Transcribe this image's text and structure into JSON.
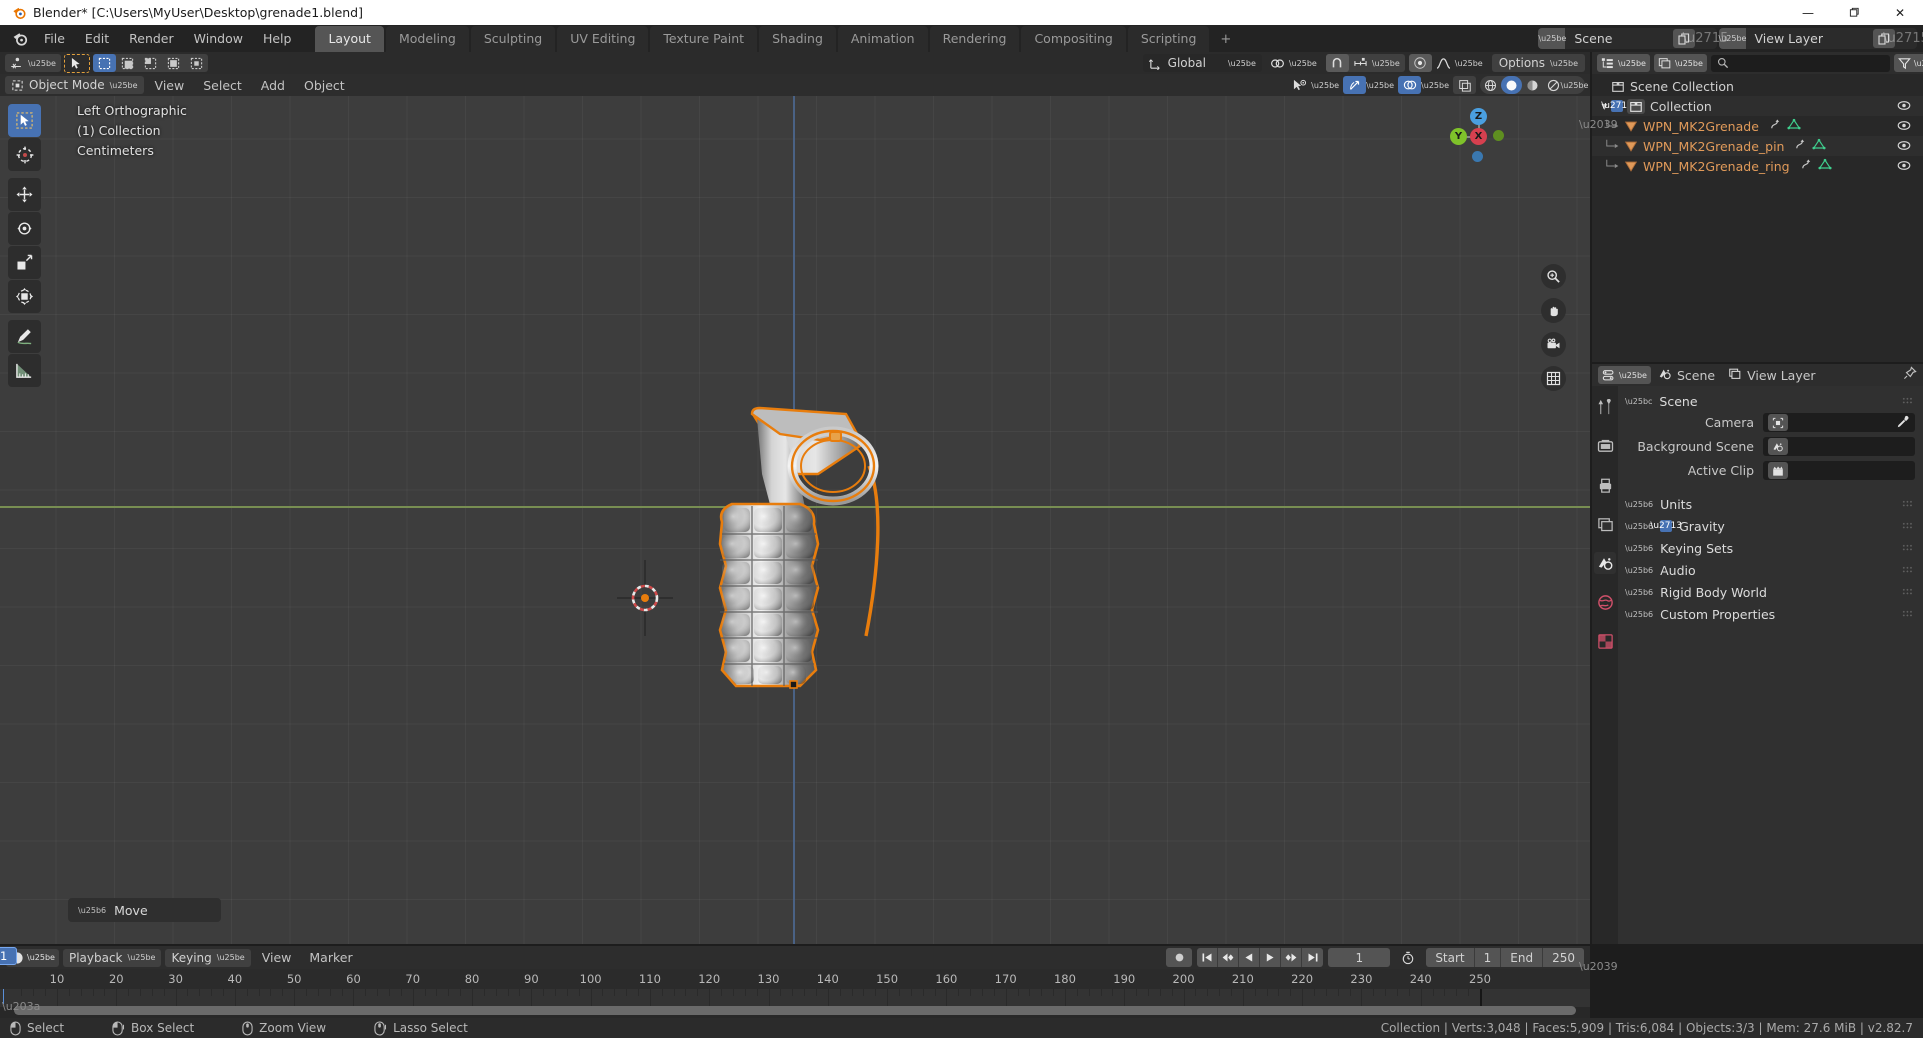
{
  "window": {
    "title": "Blender* [C:\\Users\\MyUser\\Desktop\\grenade1.blend]",
    "minimize": "—",
    "maximize": "❐",
    "close": "✕"
  },
  "topbar": {
    "menus": [
      "File",
      "Edit",
      "Render",
      "Window",
      "Help"
    ],
    "workspaces": [
      {
        "label": "Layout",
        "active": true
      },
      {
        "label": "Modeling",
        "active": false
      },
      {
        "label": "Sculpting",
        "active": false
      },
      {
        "label": "UV Editing",
        "active": false
      },
      {
        "label": "Texture Paint",
        "active": false
      },
      {
        "label": "Shading",
        "active": false
      },
      {
        "label": "Animation",
        "active": false
      },
      {
        "label": "Rendering",
        "active": false
      },
      {
        "label": "Compositing",
        "active": false
      },
      {
        "label": "Scripting",
        "active": false
      }
    ],
    "add_workspace": "+",
    "scene_name": "Scene",
    "view_layer_name": "View Layer"
  },
  "tool_header": {
    "transform_orientation": "Global",
    "options_label": "Options"
  },
  "viewport": {
    "mode": "Object Mode",
    "menus": [
      "View",
      "Select",
      "Add",
      "Object"
    ],
    "overlay": {
      "view_name": "Left Orthographic",
      "collection": "(1) Collection",
      "units": "Centimeters"
    },
    "gizmo": {
      "z": "Z",
      "y": "Y",
      "x": "X"
    },
    "operator_panel": "Move",
    "tools": [
      "select-box-tool",
      "cursor-tool",
      "move-tool",
      "rotate-tool",
      "scale-tool",
      "transform-tool",
      "annotate-tool",
      "measure-tool"
    ]
  },
  "outliner": {
    "search_placeholder": "",
    "rows": [
      {
        "label": "Scene Collection",
        "type": "collection",
        "indent": 0,
        "expand": "",
        "check": false,
        "eye": false
      },
      {
        "label": "Collection",
        "type": "collection",
        "indent": 1,
        "expand": "▼",
        "check": true,
        "eye": true
      },
      {
        "label": "WPN_MK2Grenade",
        "type": "object",
        "indent": 2,
        "expand": "▶",
        "check": false,
        "eye": true
      },
      {
        "label": "WPN_MK2Grenade_pin",
        "type": "object",
        "indent": 2,
        "expand": "▶",
        "check": false,
        "eye": true
      },
      {
        "label": "WPN_MK2Grenade_ring",
        "type": "object",
        "indent": 2,
        "expand": "▶",
        "check": false,
        "eye": true
      }
    ]
  },
  "properties": {
    "breadcrumb_scene": "Scene",
    "breadcrumb_viewlayer": "View Layer",
    "panel_scene": "Scene",
    "fields": [
      {
        "label": "Camera",
        "value": "",
        "icon": "camera-icon",
        "eyedropper": true
      },
      {
        "label": "Background Scene",
        "value": "",
        "icon": "scene-icon",
        "eyedropper": false
      },
      {
        "label": "Active Clip",
        "value": "",
        "icon": "clip-icon",
        "eyedropper": false
      }
    ],
    "sections": [
      {
        "label": "Units",
        "checkbox": false
      },
      {
        "label": "Gravity",
        "checkbox": true
      },
      {
        "label": "Keying Sets",
        "checkbox": false
      },
      {
        "label": "Audio",
        "checkbox": false
      },
      {
        "label": "Rigid Body World",
        "checkbox": false
      },
      {
        "label": "Custom Properties",
        "checkbox": false
      }
    ]
  },
  "timeline": {
    "menus": [
      "Playback",
      "Keying",
      "View",
      "Marker"
    ],
    "current_frame": "1",
    "start_label": "Start",
    "start_value": "1",
    "end_label": "End",
    "end_value": "250",
    "playhead_label": "1",
    "ticks": [
      10,
      20,
      30,
      40,
      50,
      60,
      70,
      80,
      90,
      100,
      110,
      120,
      130,
      140,
      150,
      160,
      170,
      180,
      190,
      200,
      210,
      220,
      230,
      240,
      250
    ]
  },
  "statusbar": {
    "hints": [
      {
        "mouse": "left",
        "label": "Select"
      },
      {
        "mouse": "left-drag",
        "label": "Box Select"
      },
      {
        "mouse": "middle",
        "label": "Zoom View"
      },
      {
        "mouse": "middle-drag",
        "label": "Lasso Select"
      }
    ],
    "stats": "Collection | Verts:3,048 | Faces:5,909 | Tris:6,084 | Objects:3/3 | Mem: 27.6 MiB | v2.82.7"
  },
  "colors": {
    "accent_blue": "#4772b3",
    "selected_orange": "#e87d0d",
    "object_orange": "#e09a5a",
    "viewport_bg": "#3d3d3d",
    "panel_bg": "#303030",
    "header_bg": "#2d2d2d"
  }
}
